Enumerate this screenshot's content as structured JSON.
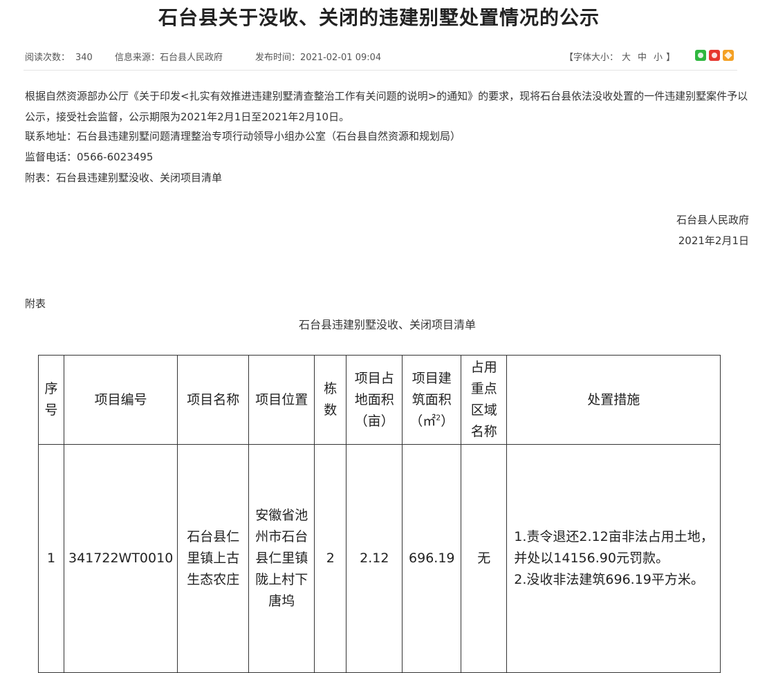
{
  "title": "石台县关于没收、关闭的违建别墅处置情况的公示",
  "meta": {
    "views_label": "阅读次数：",
    "views": "340",
    "source_label": "信息来源：",
    "source": "石台县人民政府",
    "published_label": "发布时间：",
    "published": "2021-02-01 09:04",
    "font_size_label": "【字体大小：",
    "font_large": "大",
    "font_medium": "中",
    "font_small": "小",
    "font_size_end": "】"
  },
  "share_icons": [
    "wechat-icon",
    "weibo-icon",
    "favorite-icon"
  ],
  "content": {
    "paragraph_1": "根据自然资源部办公厅《关于印发<扎实有效推进违建别墅清查整治工作有关问题的说明>的通知》的要求，现将石台县依法没收处置的一件违建别墅案件予以公示，接受社会监督，公示期限为2021年2月1日至2021年2月10日。",
    "contact": "联系地址：石台县违建别墅问题清理整治专项行动领导小组办公室（石台县自然资源和规划局）",
    "phone": "监督电话：0566-6023495",
    "attachment": "附表：石台县违建别墅没收、关闭项目清单",
    "signature_org": "石台县人民政府",
    "signature_date": "2021年2月1日",
    "appendix_label": "附表",
    "table_caption": "石台县违建别墅没收、关闭项目清单"
  },
  "table": {
    "headers": {
      "seq": "序号",
      "code": "项目编号",
      "name": "项目名称",
      "location": "项目位置",
      "buildings": "栋数",
      "land_area": "项目占地面积（亩）",
      "floor_area_prefix": "项目建筑面积（㎡",
      "floor_area_sup": "2",
      "floor_area_suffix": "）",
      "key_area": "占用重点区域名称",
      "measures": "处置措施"
    },
    "rows": [
      {
        "seq": "1",
        "code": "341722WT0010",
        "name": "石台县仁里镇上古生态农庄",
        "location": "安徽省池州市石台县仁里镇陇上村下唐坞",
        "buildings": "2",
        "land_area": "2.12",
        "floor_area": "696.19",
        "key_area": "无",
        "measure_1": "1.责令退还2.12亩非法占用土地，并处以14156.90元罚款。",
        "measure_2": "2.没收非法建筑696.19平方米。"
      }
    ]
  },
  "colors": {
    "title": "#222222",
    "text": "#333333",
    "meta": "#555555",
    "border": "#333333",
    "wechat": "#2fb73f",
    "weibo": "#e6372f",
    "favorite": "#f4a023"
  }
}
